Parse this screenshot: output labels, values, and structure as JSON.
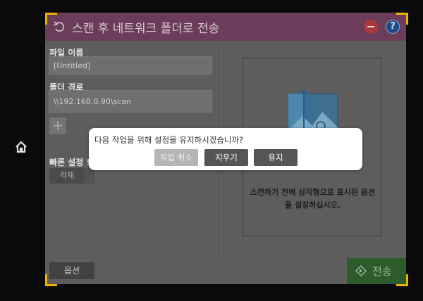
{
  "header": {
    "title": "스캔 후 네트워크 폴더로 전송",
    "back_icon": "undo-arrow-icon",
    "stop_icon": "stop-icon",
    "help_label": "?"
  },
  "form": {
    "file_name_label": "파일 이름",
    "file_name_value": "[Untitled]",
    "folder_path_label": "폴더 경로",
    "folder_path_value": "\\\\192.168.0.90\\scan",
    "add_label": "+",
    "quick_settings_label": "빠른 설정 !",
    "quick_tab_label": "적재"
  },
  "preview": {
    "hint": "스캔하기 전에 삼각형으로 표시된 옵션을 설정하십시오."
  },
  "footer": {
    "options_label": "옵션",
    "send_label": "전송"
  },
  "dialog": {
    "message": "다음 작업을 위해 설정을 유지하시겠습니까?",
    "cancel_label": "작업 취소",
    "clear_label": "지우기",
    "keep_label": "유지"
  },
  "colors": {
    "titlebar": "#6b3d5a",
    "send": "#2c5b2c",
    "accent_corner": "#e8b400"
  }
}
